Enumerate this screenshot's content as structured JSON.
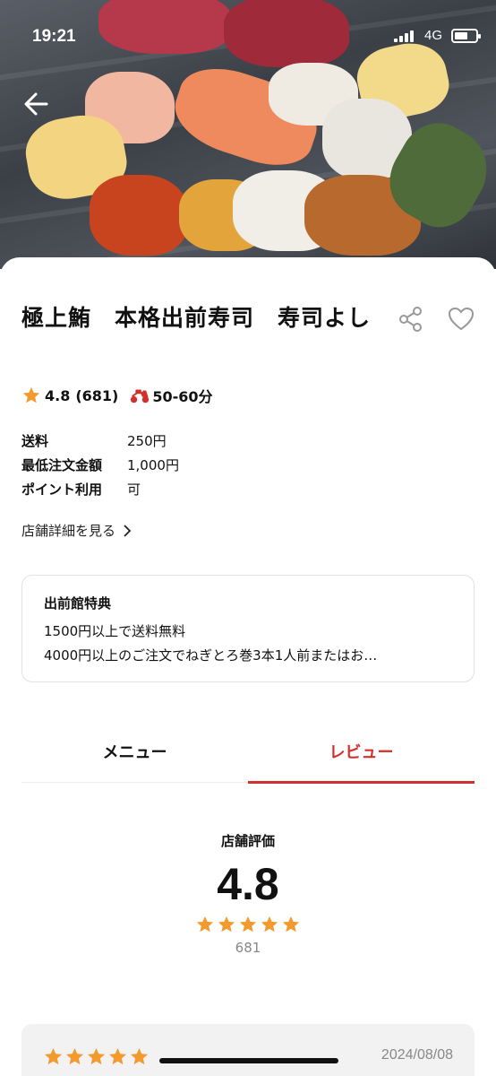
{
  "status_bar": {
    "time": "19:21",
    "network": "4G"
  },
  "store": {
    "name": "極上鮪　本格出前寿司　寿司よし",
    "rating": "4.8",
    "review_count_paren": "(681)",
    "delivery_time": "50-60分"
  },
  "fees": [
    {
      "label": "送料",
      "value": "250円"
    },
    {
      "label": "最低注文金額",
      "value": "1,000円"
    },
    {
      "label": "ポイント利用",
      "value": "可"
    }
  ],
  "detail_link": "店舗詳細を見る",
  "benefit": {
    "title": "出前館特典",
    "lines": [
      "1500円以上で送料無料",
      "4000円以上のご注文でねぎとろ巻3本1人前またはお…"
    ]
  },
  "tabs": [
    {
      "label": "メニュー",
      "active": false
    },
    {
      "label": "レビュー",
      "active": true
    }
  ],
  "rating_summary": {
    "label": "店舗評価",
    "value": "4.8",
    "stars": 5,
    "count": "681"
  },
  "review": {
    "stars": 5,
    "date": "2024/08/08"
  },
  "colors": {
    "accent": "#d0312d",
    "star": "#f29a2e",
    "bike": "#d0312d"
  },
  "icons": [
    "back-arrow-icon",
    "share-icon",
    "heart-icon",
    "star-icon",
    "scooter-icon",
    "chevron-right-icon"
  ]
}
